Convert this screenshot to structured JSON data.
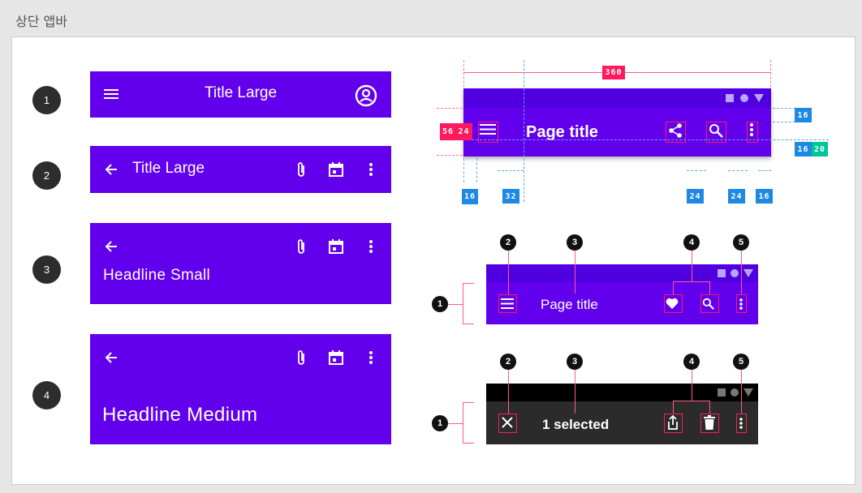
{
  "page": {
    "header": "상단 앱바"
  },
  "variants": [
    {
      "number": "1",
      "title": "Title Large",
      "nav_icon": "menu-icon",
      "actions": [
        "account-circle-icon"
      ]
    },
    {
      "number": "2",
      "title": "Title Large",
      "nav_icon": "arrow-back-icon",
      "actions": [
        "attach-icon",
        "calendar-icon",
        "more-vert-icon"
      ]
    },
    {
      "number": "3",
      "title": "Headline Small",
      "nav_icon": "arrow-back-icon",
      "actions": [
        "attach-icon",
        "calendar-icon",
        "more-vert-icon"
      ]
    },
    {
      "number": "4",
      "title": "Headline Medium",
      "nav_icon": "arrow-back-icon",
      "actions": [
        "attach-icon",
        "calendar-icon",
        "more-vert-icon"
      ]
    }
  ],
  "spec": {
    "title": "Page title",
    "width_label": "360",
    "height_label": "56",
    "margin_left_label": "24",
    "right_labels": [
      "16",
      "16",
      "20"
    ],
    "bottom_labels": [
      "16",
      "32",
      "24",
      "24",
      "16"
    ]
  },
  "anatomy_regular": {
    "title": "Page title",
    "markers": [
      "1",
      "2",
      "3",
      "4",
      "5"
    ]
  },
  "anatomy_contextual": {
    "title": "1 selected",
    "markers": [
      "1",
      "2",
      "3",
      "4",
      "5"
    ]
  },
  "colors": {
    "primary": "#6200ee",
    "status": "#5000e0",
    "contextual": "#2b2b2b",
    "redline": "#ff1a5e",
    "blueline": "#1e88e5"
  }
}
